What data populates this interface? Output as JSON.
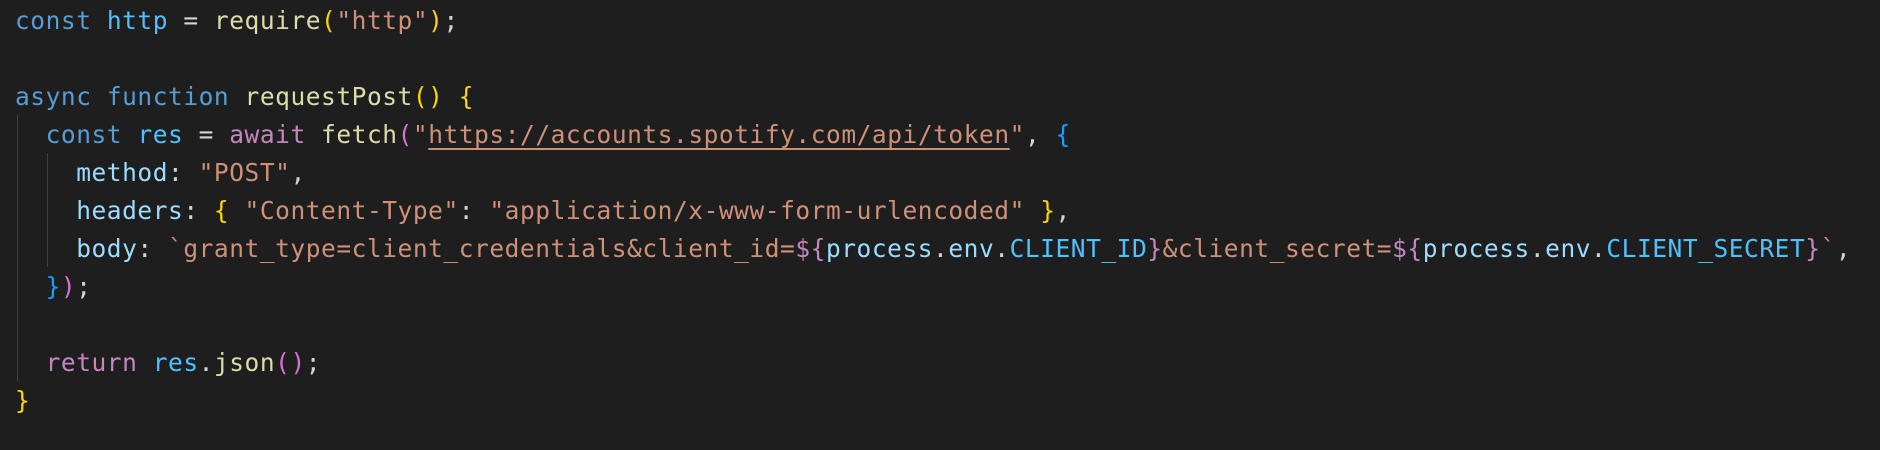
{
  "editor": {
    "language": "javascript",
    "theme_colors": {
      "background": "#1e1e1e",
      "keyword": "#569cd6",
      "control_keyword": "#c586c0",
      "variable": "#4fc1ff",
      "property": "#9cdcfe",
      "function": "#dcdcaa",
      "string": "#ce9178",
      "punctuation": "#d4d4d4",
      "bracket_level1": "#ffd700",
      "bracket_level2": "#da70d6",
      "bracket_level3": "#179fff"
    },
    "lines": [
      {
        "tokens": [
          {
            "t": "const",
            "k": "storage"
          },
          {
            "t": " ",
            "k": "punct"
          },
          {
            "t": "http",
            "k": "var"
          },
          {
            "t": " = ",
            "k": "punct"
          },
          {
            "t": "require",
            "k": "fn"
          },
          {
            "t": "(",
            "k": "br1"
          },
          {
            "t": "\"http\"",
            "k": "str"
          },
          {
            "t": ")",
            "k": "br1"
          },
          {
            "t": ";",
            "k": "punct"
          }
        ]
      },
      {
        "tokens": []
      },
      {
        "tokens": [
          {
            "t": "async",
            "k": "storage"
          },
          {
            "t": " ",
            "k": "punct"
          },
          {
            "t": "function",
            "k": "storage"
          },
          {
            "t": " ",
            "k": "punct"
          },
          {
            "t": "requestPost",
            "k": "fn"
          },
          {
            "t": "()",
            "k": "br1"
          },
          {
            "t": " ",
            "k": "punct"
          },
          {
            "t": "{",
            "k": "br1"
          }
        ]
      },
      {
        "tokens": [
          {
            "t": "  ",
            "k": "punct"
          },
          {
            "t": "const",
            "k": "storage"
          },
          {
            "t": " ",
            "k": "punct"
          },
          {
            "t": "res",
            "k": "var"
          },
          {
            "t": " = ",
            "k": "punct"
          },
          {
            "t": "await",
            "k": "control"
          },
          {
            "t": " ",
            "k": "punct"
          },
          {
            "t": "fetch",
            "k": "fn"
          },
          {
            "t": "(",
            "k": "br2"
          },
          {
            "t": "\"",
            "k": "str"
          },
          {
            "t": "https://accounts.spotify.com/api/token",
            "k": "link"
          },
          {
            "t": "\"",
            "k": "str"
          },
          {
            "t": ", ",
            "k": "punct"
          },
          {
            "t": "{",
            "k": "br3"
          }
        ]
      },
      {
        "tokens": [
          {
            "t": "    ",
            "k": "punct"
          },
          {
            "t": "method",
            "k": "prop"
          },
          {
            "t": ": ",
            "k": "punct"
          },
          {
            "t": "\"POST\"",
            "k": "str"
          },
          {
            "t": ",",
            "k": "punct"
          }
        ]
      },
      {
        "tokens": [
          {
            "t": "    ",
            "k": "punct"
          },
          {
            "t": "headers",
            "k": "prop"
          },
          {
            "t": ": ",
            "k": "punct"
          },
          {
            "t": "{",
            "k": "br1"
          },
          {
            "t": " ",
            "k": "punct"
          },
          {
            "t": "\"Content-Type\"",
            "k": "str"
          },
          {
            "t": ": ",
            "k": "punct"
          },
          {
            "t": "\"application/x-www-form-urlencoded\"",
            "k": "str"
          },
          {
            "t": " ",
            "k": "punct"
          },
          {
            "t": "}",
            "k": "br1"
          },
          {
            "t": ",",
            "k": "punct"
          }
        ]
      },
      {
        "tokens": [
          {
            "t": "    ",
            "k": "punct"
          },
          {
            "t": "body",
            "k": "prop"
          },
          {
            "t": ": ",
            "k": "punct"
          },
          {
            "t": "`grant_type=client_credentials&client_id=",
            "k": "str"
          },
          {
            "t": "${",
            "k": "control"
          },
          {
            "t": "process",
            "k": "prop"
          },
          {
            "t": ".",
            "k": "punct"
          },
          {
            "t": "env",
            "k": "prop"
          },
          {
            "t": ".",
            "k": "punct"
          },
          {
            "t": "CLIENT_ID",
            "k": "const"
          },
          {
            "t": "}",
            "k": "control"
          },
          {
            "t": "&client_secret=",
            "k": "str"
          },
          {
            "t": "${",
            "k": "control"
          },
          {
            "t": "process",
            "k": "prop"
          },
          {
            "t": ".",
            "k": "punct"
          },
          {
            "t": "env",
            "k": "prop"
          },
          {
            "t": ".",
            "k": "punct"
          },
          {
            "t": "CLIENT_SECRET",
            "k": "const"
          },
          {
            "t": "}",
            "k": "control"
          },
          {
            "t": "`",
            "k": "str"
          },
          {
            "t": ",",
            "k": "punct"
          }
        ]
      },
      {
        "tokens": [
          {
            "t": "  ",
            "k": "punct"
          },
          {
            "t": "}",
            "k": "br3"
          },
          {
            "t": ")",
            "k": "br2"
          },
          {
            "t": ";",
            "k": "punct"
          }
        ]
      },
      {
        "tokens": []
      },
      {
        "tokens": [
          {
            "t": "  ",
            "k": "punct"
          },
          {
            "t": "return",
            "k": "control"
          },
          {
            "t": " ",
            "k": "punct"
          },
          {
            "t": "res",
            "k": "var"
          },
          {
            "t": ".",
            "k": "punct"
          },
          {
            "t": "json",
            "k": "fn"
          },
          {
            "t": "()",
            "k": "br2"
          },
          {
            "t": ";",
            "k": "punct"
          }
        ]
      },
      {
        "tokens": [
          {
            "t": "}",
            "k": "br1"
          }
        ]
      }
    ]
  }
}
